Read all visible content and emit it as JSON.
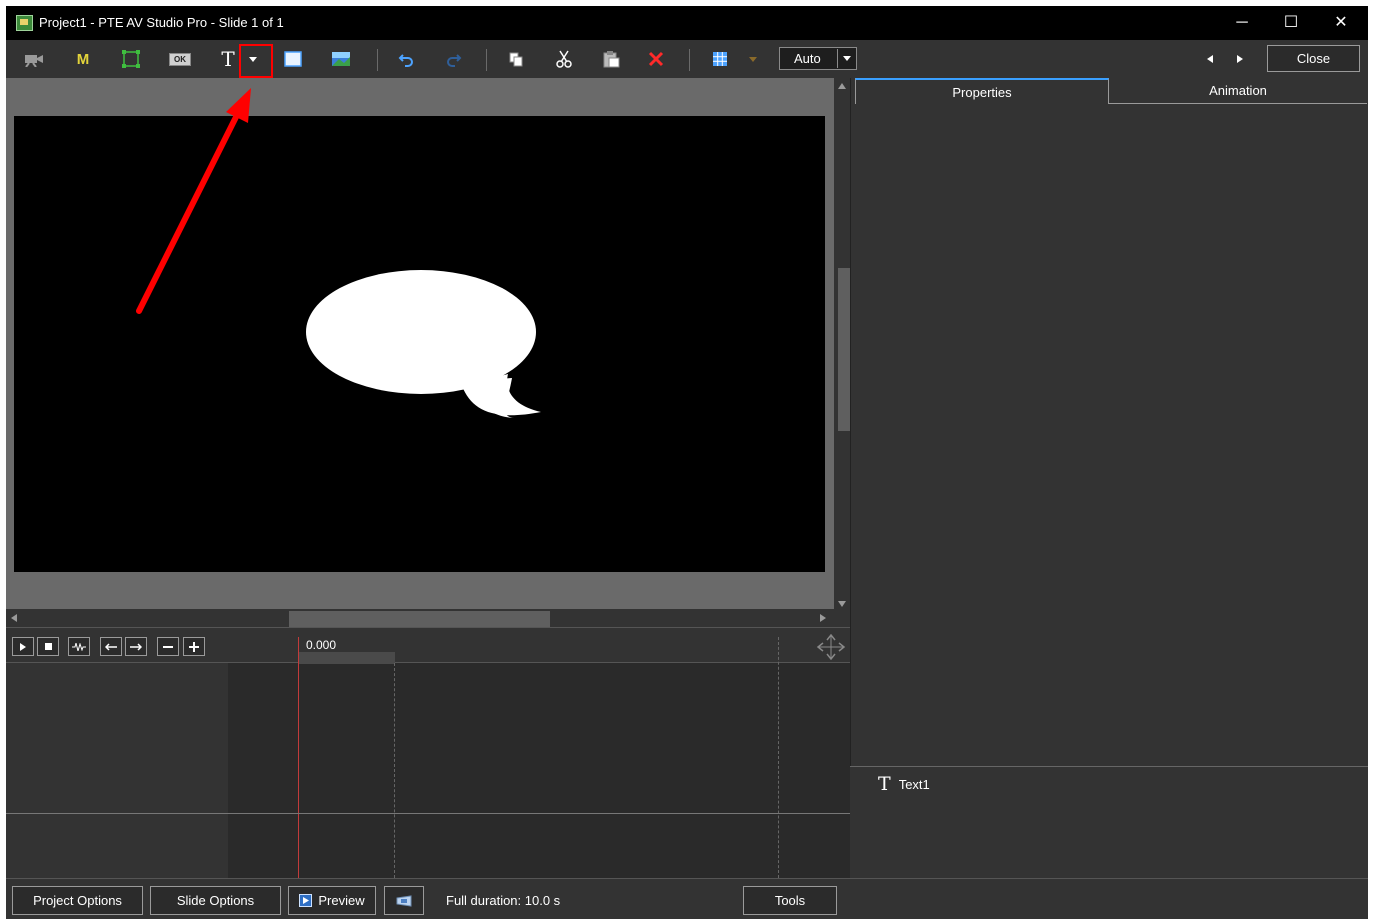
{
  "window": {
    "title": "Project1 - PTE AV Studio Pro - Slide 1 of 1",
    "minimize_glyph": "─",
    "maximize_glyph": "☐",
    "close_glyph": "✕"
  },
  "toolbar": {
    "icons": [
      "camera-icon",
      "mask-icon",
      "frame-icon",
      "button-icon",
      "text-icon",
      "text-dropdown-icon",
      "rectangle-icon",
      "image-icon",
      "undo-icon",
      "redo-icon",
      "copy-icon",
      "cut-icon",
      "paste-icon",
      "delete-icon",
      "grid-icon",
      "grid-dropdown-icon"
    ],
    "text_glyph": "T",
    "mask_glyph": "M",
    "ok_glyph": "OK",
    "zoom_value": "Auto",
    "close_label": "Close"
  },
  "right_panel": {
    "tabs": [
      {
        "label": "Properties",
        "active": true
      },
      {
        "label": "Animation",
        "active": false
      }
    ],
    "objects": [
      {
        "icon": "text-object-icon",
        "glyph": "T",
        "label": "Text1"
      }
    ]
  },
  "timeline": {
    "time": "0.000"
  },
  "bottom_bar": {
    "project_options": "Project Options",
    "slide_options": "Slide Options",
    "preview": "Preview",
    "full_duration": "Full duration: 10.0 s",
    "tools": "Tools"
  },
  "colors": {
    "background": "#333333",
    "accent_tab": "#3aa0ff",
    "annotation": "#ff0000",
    "slide": "#000000",
    "shape": "#ffffff"
  }
}
